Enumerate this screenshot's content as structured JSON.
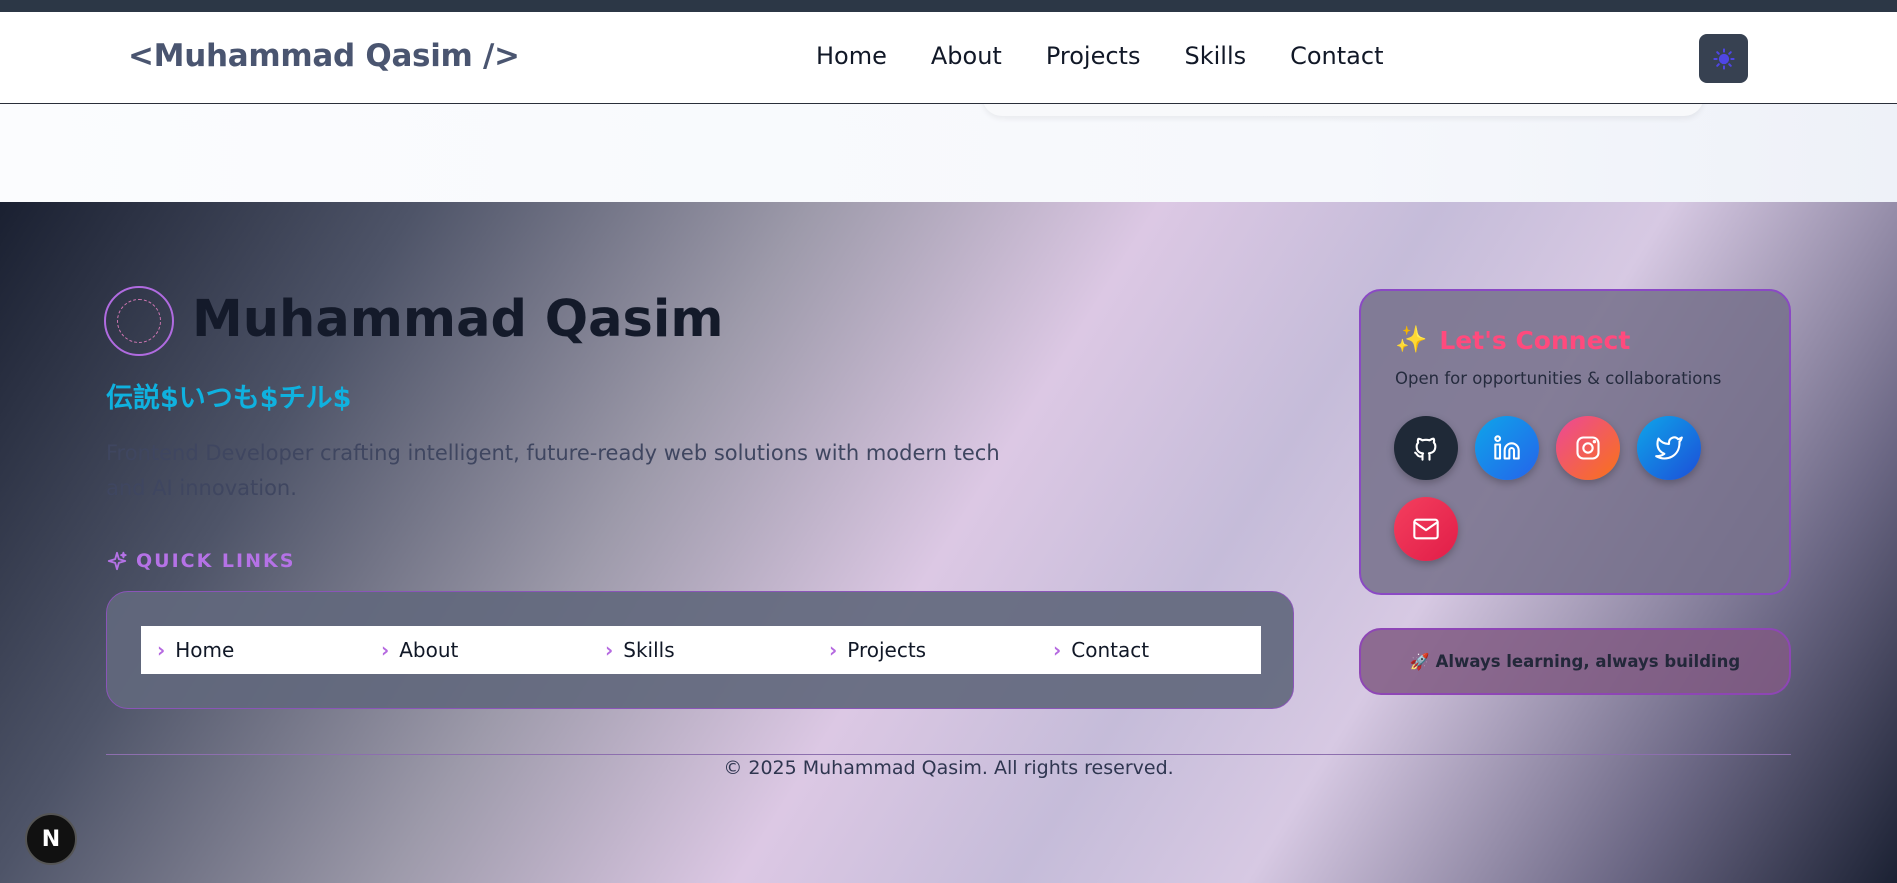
{
  "header": {
    "brand": "<Muhammad Qasim />",
    "nav": [
      "Home",
      "About",
      "Projects",
      "Skills",
      "Contact"
    ],
    "theme_icon": "sun-icon"
  },
  "footer": {
    "name": "Muhammad Qasim",
    "tagline": "伝説$いつも$チル$",
    "description": "Frontend Developer crafting intelligent, future-ready web solutions with modern tech and AI innovation.",
    "quick_links_title": "QUICK LINKS",
    "quick_links": [
      "Home",
      "About",
      "Skills",
      "Projects",
      "Contact"
    ],
    "connect": {
      "title": "Let's Connect",
      "subtitle": "Open for opportunities & collaborations",
      "socials": [
        {
          "name": "github-icon",
          "color": "#1f2937"
        },
        {
          "name": "linkedin-icon",
          "color": "#0ea5e9"
        },
        {
          "name": "instagram-icon",
          "color": "#f43f5e"
        },
        {
          "name": "twitter-icon",
          "color": "#0284c7"
        },
        {
          "name": "mail-icon",
          "color": "#f43f5e"
        }
      ]
    },
    "learning": "Always learning, always building",
    "copyright": "© 2025 Muhammad Qasim. All rights reserved.",
    "dev_badge": "N"
  },
  "colors": {
    "accent_purple": "#b572e6",
    "tagline_cyan": "#0fb1df",
    "connect_pink": "#ff4a7d"
  }
}
